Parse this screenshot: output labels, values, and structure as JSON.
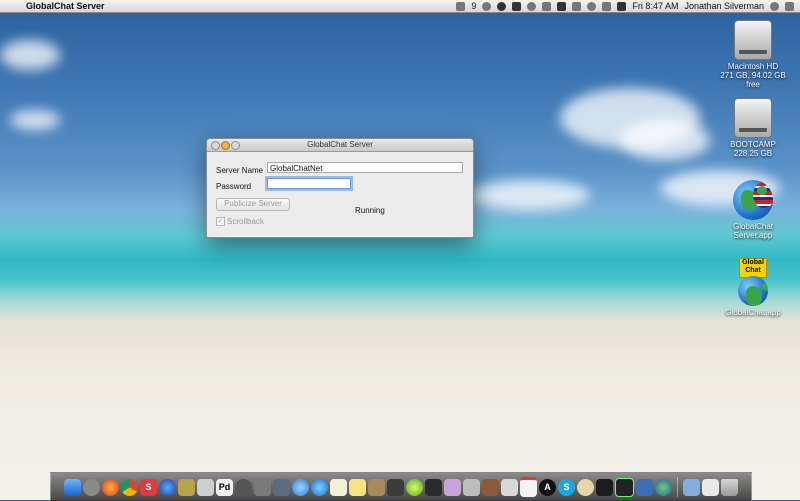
{
  "menubar": {
    "app_name": "GlobalChat Server",
    "status_number": "9",
    "clock": "Fri 8:47 AM",
    "user": "Jonathan Silverman"
  },
  "desktop": {
    "items": [
      {
        "name": "Macintosh HD",
        "detail": "271 GB, 94.02 GB free",
        "icon": "hard-drive-icon"
      },
      {
        "name": "BOOTCAMP",
        "detail": "228.25 GB",
        "icon": "hard-drive-icon"
      },
      {
        "name": "GlobalChat Server.app",
        "icon": "globe-flag-icon"
      },
      {
        "name": "GlobalChat.app",
        "icon": "globe-icon",
        "sticker": "Global Chat"
      }
    ]
  },
  "window": {
    "title": "GlobalChat Server",
    "server_name_label": "Server Name",
    "server_name_value": "GlobalChatNet",
    "password_label": "Password",
    "password_value": "",
    "publicize_button": "Publicize Server",
    "status": "Running",
    "scrollback_label": "Scrollback",
    "scrollback_checked": true
  },
  "dock": {
    "icons": [
      "finder-icon",
      "launchpad-icon",
      "firefox-icon",
      "chrome-icon",
      "s-app-icon",
      "globe-app-icon",
      "star-app-icon",
      "cube-app-icon",
      "pd-icon",
      "clock-app-icon",
      "camera-app-icon",
      "network-icon",
      "itunes-icon",
      "app-store-icon",
      "notes-icon",
      "stickies-icon",
      "preview-icon",
      "terminal-icon",
      "lime-app-icon",
      "cat-app-icon",
      "photo-app-icon",
      "cd-app-icon",
      "mask-app-icon",
      "photos-icon",
      "calendar-icon",
      "circle-a-icon",
      "skype-icon",
      "map-icon",
      "terminal-dark-icon",
      "activity-monitor-icon",
      "xcode-icon",
      "globalchat-icon",
      "downloads-icon",
      "documents-icon",
      "trash-icon"
    ],
    "texts": {
      "pd": "Pd",
      "skype": "S",
      "s_app": "S",
      "a": "A"
    }
  }
}
